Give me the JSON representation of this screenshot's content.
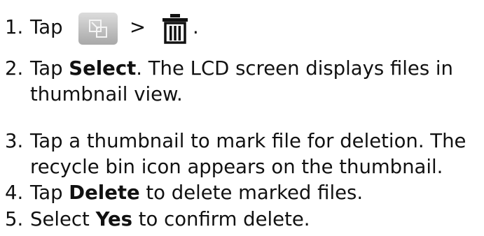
{
  "steps": [
    {
      "num": "1.",
      "tap": "Tap",
      "gt": ">",
      "end": ".",
      "icons": [
        "thumbnail-view-button-icon",
        "trash-icon"
      ]
    },
    {
      "num": "2.",
      "line1_pre": "Tap ",
      "line1_bold": "Select",
      "line1_post": ". The LCD screen displays files in",
      "line2": "thumbnail view."
    },
    {
      "num": "3.",
      "line1": "Tap a thumbnail to mark file for deletion. The",
      "line2": "recycle bin icon appears on the thumbnail."
    },
    {
      "num": "4.",
      "pre": "Tap ",
      "bold": "Delete",
      "post": " to delete marked files."
    },
    {
      "num": "5.",
      "pre": "Select ",
      "bold": "Yes",
      "post": " to confirm delete."
    }
  ],
  "colors": {
    "text": "#111111",
    "button_top": "#dcdcdc",
    "button_bottom": "#a8a8a8"
  }
}
